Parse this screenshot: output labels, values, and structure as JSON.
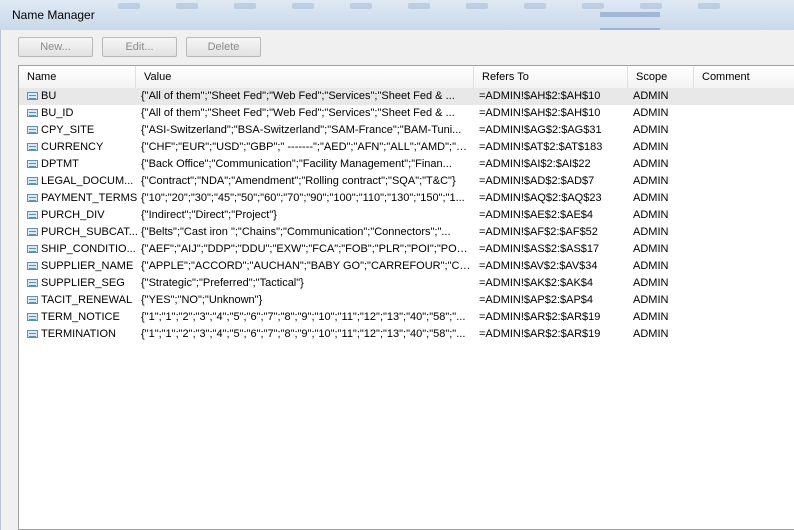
{
  "window": {
    "title": "Name Manager"
  },
  "toolbar": {
    "new_label": "New...",
    "edit_label": "Edit...",
    "delete_label": "Delete"
  },
  "columns": [
    "Name",
    "Value",
    "Refers To",
    "Scope",
    "Comment"
  ],
  "rows": [
    {
      "name": "BU",
      "value": "{\"All of them\";\"Sheet Fed\";\"Web Fed\";\"Services\";\"Sheet Fed & ...",
      "refers_to": "=ADMIN!$AH$2:$AH$10",
      "scope": "ADMIN",
      "comment": "",
      "icon": "range-name-icon"
    },
    {
      "name": "BU_ID",
      "value": "{\"All of them\";\"Sheet Fed\";\"Web Fed\";\"Services\";\"Sheet Fed & ...",
      "refers_to": "=ADMIN!$AH$2:$AH$10",
      "scope": "ADMIN",
      "comment": "",
      "icon": "range-name-icon"
    },
    {
      "name": "CPY_SITE",
      "value": "{\"ASI-Switzerland\";\"BSA-Switzerland\";\"SAM-France\";\"BAM-Tuni...",
      "refers_to": "=ADMIN!$AG$2:$AG$31",
      "scope": "ADMIN",
      "comment": "",
      "icon": "range-name-icon"
    },
    {
      "name": "CURRENCY",
      "value": "{\"CHF\";\"EUR\";\"USD\";\"GBP\";\" -------\";\"AED\";\"AFN\";\"ALL\";\"AMD\";\"A...",
      "refers_to": "=ADMIN!$AT$2:$AT$183",
      "scope": "ADMIN",
      "comment": "",
      "icon": "range-name-icon"
    },
    {
      "name": "DPTMT",
      "value": "{\"Back Office\";\"Communication\";\"Facility Management\";\"Finan...",
      "refers_to": "=ADMIN!$AI$2:$AI$22",
      "scope": "ADMIN",
      "comment": "",
      "icon": "range-name-icon"
    },
    {
      "name": "LEGAL_DOCUM...",
      "value": "{\"Contract\";\"NDA\";\"Amendment\";\"Rolling contract\";\"SQA\";\"T&C\"}",
      "refers_to": "=ADMIN!$AD$2:$AD$7",
      "scope": "ADMIN",
      "comment": "",
      "icon": "range-name-icon"
    },
    {
      "name": "PAYMENT_TERMS",
      "value": "{\"10\";\"20\";\"30\";\"45\";\"50\";\"60\";\"70\";\"90\";\"100\";\"110\";\"130\";\"150\";\"1...",
      "refers_to": "=ADMIN!$AQ$2:$AQ$23",
      "scope": "ADMIN",
      "comment": "",
      "icon": "range-name-icon"
    },
    {
      "name": "PURCH_DIV",
      "value": "{\"Indirect\";\"Direct\";\"Project\"}",
      "refers_to": "=ADMIN!$AE$2:$AE$4",
      "scope": "ADMIN",
      "comment": "",
      "icon": "range-name-icon"
    },
    {
      "name": "PURCH_SUBCAT...",
      "value": "{\"Belts\";\"Cast iron \";\"Chains\";\"Communication\";\"Connectors\";\"...",
      "refers_to": "=ADMIN!$AF$2:$AF$52",
      "scope": "ADMIN",
      "comment": "",
      "icon": "range-name-icon"
    },
    {
      "name": "SHIP_CONDITIO...",
      "value": "{\"AEF\";\"AIJ\";\"DDP\";\"DDU\";\"EXW\";\"FCA\";\"FOB\";\"PLR\";\"POI\";\"POL\";...",
      "refers_to": "=ADMIN!$AS$2:$AS$17",
      "scope": "ADMIN",
      "comment": "",
      "icon": "range-name-icon"
    },
    {
      "name": "SUPPLIER_NAME",
      "value": "{\"APPLE\";\"ACCORD\";\"AUCHAN\";\"BABY GO\";\"CARREFOUR\";\"CASI...",
      "refers_to": "=ADMIN!$AV$2:$AV$34",
      "scope": "ADMIN",
      "comment": "",
      "icon": "range-name-icon"
    },
    {
      "name": "SUPPLIER_SEG",
      "value": "{\"Strategic\";\"Preferred\";\"Tactical\"}",
      "refers_to": "=ADMIN!$AK$2:$AK$4",
      "scope": "ADMIN",
      "comment": "",
      "icon": "range-name-icon"
    },
    {
      "name": "TACIT_RENEWAL",
      "value": "{\"YES\";\"NO\";\"Unknown\"}",
      "refers_to": "=ADMIN!$AP$2:$AP$4",
      "scope": "ADMIN",
      "comment": "",
      "icon": "range-name-icon"
    },
    {
      "name": "TERM_NOTICE",
      "value": "{\"1\";\"1\";\"2\";\"3\";\"4\";\"5\";\"6\";\"7\";\"8\";\"9\";\"10\";\"11\";\"12\";\"13\";\"40\";\"58\";\"...",
      "refers_to": "=ADMIN!$AR$2:$AR$19",
      "scope": "ADMIN",
      "comment": "",
      "icon": "range-name-icon"
    },
    {
      "name": "TERMINATION",
      "value": "{\"1\";\"1\";\"2\";\"3\";\"4\";\"5\";\"6\";\"7\";\"8\";\"9\";\"10\";\"11\";\"12\";\"13\";\"40\";\"58\";\"...",
      "refers_to": "=ADMIN!$AR$2:$AR$19",
      "scope": "ADMIN",
      "comment": "",
      "icon": "range-name-icon"
    }
  ]
}
